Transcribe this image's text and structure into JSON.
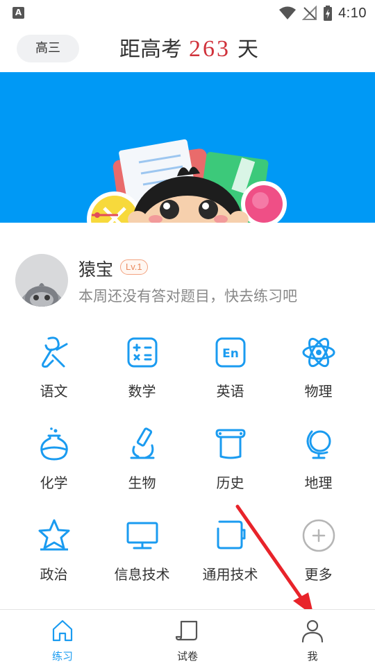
{
  "status_bar": {
    "notification_icon": "A",
    "time": "4:10"
  },
  "header": {
    "grade_label": "高三",
    "countdown_prefix": "距高考",
    "countdown_days": "263",
    "countdown_suffix": "天"
  },
  "user": {
    "name": "猿宝",
    "level": "Lv.1",
    "message": "本周还没有答对题目，快去练习吧"
  },
  "subjects": [
    {
      "label": "语文",
      "icon": "chinese-icon"
    },
    {
      "label": "数学",
      "icon": "math-icon"
    },
    {
      "label": "英语",
      "icon": "english-icon",
      "icon_text": "En"
    },
    {
      "label": "物理",
      "icon": "physics-icon"
    },
    {
      "label": "化学",
      "icon": "chemistry-icon"
    },
    {
      "label": "生物",
      "icon": "biology-icon"
    },
    {
      "label": "历史",
      "icon": "history-icon"
    },
    {
      "label": "地理",
      "icon": "geography-icon"
    },
    {
      "label": "政治",
      "icon": "politics-icon"
    },
    {
      "label": "信息技术",
      "icon": "it-icon"
    },
    {
      "label": "通用技术",
      "icon": "general-tech-icon"
    },
    {
      "label": "更多",
      "icon": "more-icon"
    }
  ],
  "nav": {
    "items": [
      {
        "label": "练习",
        "icon": "home-icon",
        "active": true
      },
      {
        "label": "试卷",
        "icon": "paper-icon",
        "active": false
      },
      {
        "label": "我",
        "icon": "person-icon",
        "active": false
      }
    ]
  },
  "colors": {
    "accent": "#1a9bf0",
    "banner": "#0099f5",
    "countdown": "#d0313a",
    "annotation_arrow": "#e8232a"
  }
}
